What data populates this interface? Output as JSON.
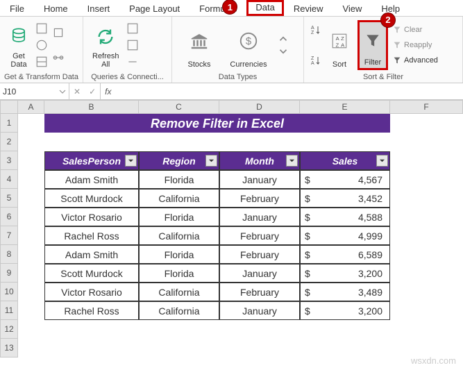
{
  "menu": {
    "tabs": [
      "File",
      "Home",
      "Insert",
      "Page Layout",
      "Formulas",
      "Data",
      "Review",
      "View",
      "Help"
    ],
    "highlighted_index": 5
  },
  "annotations": {
    "badge1": "1",
    "badge2": "2"
  },
  "ribbon": {
    "get_data": "Get\nData",
    "group_get": "Get & Transform Data",
    "refresh": "Refresh\nAll",
    "group_queries": "Queries & Connecti...",
    "stocks": "Stocks",
    "currencies": "Currencies",
    "group_types": "Data Types",
    "sort_az": "A→Z",
    "sort_za": "Z→A",
    "sort": "Sort",
    "filter": "Filter",
    "clear": "Clear",
    "reapply": "Reapply",
    "advanced": "Advanced",
    "group_sort": "Sort & Filter"
  },
  "formula_bar": {
    "namebox": "J10",
    "fx": "fx"
  },
  "columns": [
    "A",
    "B",
    "C",
    "D",
    "E",
    "F"
  ],
  "row_labels": [
    "1",
    "2",
    "3",
    "4",
    "5",
    "6",
    "7",
    "8",
    "9",
    "10",
    "11",
    "12",
    "13"
  ],
  "title": "Remove Filter in Excel",
  "headers": [
    "SalesPerson",
    "Region",
    "Month",
    "Sales"
  ],
  "chart_data": {
    "type": "table",
    "columns": [
      "SalesPerson",
      "Region",
      "Month",
      "Sales"
    ],
    "rows": [
      {
        "SalesPerson": "Adam Smith",
        "Region": "Florida",
        "Month": "January",
        "Sales": 4567,
        "SalesStr": "4,567"
      },
      {
        "SalesPerson": "Scott Murdock",
        "Region": "California",
        "Month": "February",
        "Sales": 3452,
        "SalesStr": "3,452"
      },
      {
        "SalesPerson": "Victor Rosario",
        "Region": "Florida",
        "Month": "January",
        "Sales": 4588,
        "SalesStr": "4,588"
      },
      {
        "SalesPerson": "Rachel Ross",
        "Region": "California",
        "Month": "February",
        "Sales": 4999,
        "SalesStr": "4,999"
      },
      {
        "SalesPerson": "Adam Smith",
        "Region": "Florida",
        "Month": "February",
        "Sales": 6589,
        "SalesStr": "6,589"
      },
      {
        "SalesPerson": "Scott Murdock",
        "Region": "Florida",
        "Month": "January",
        "Sales": 3200,
        "SalesStr": "3,200"
      },
      {
        "SalesPerson": "Victor Rosario",
        "Region": "California",
        "Month": "February",
        "Sales": 3489,
        "SalesStr": "3,489"
      },
      {
        "SalesPerson": "Rachel Ross",
        "Region": "California",
        "Month": "January",
        "Sales": 3200,
        "SalesStr": "3,200"
      }
    ]
  },
  "currency": "$",
  "watermark": "wsxdn.com"
}
